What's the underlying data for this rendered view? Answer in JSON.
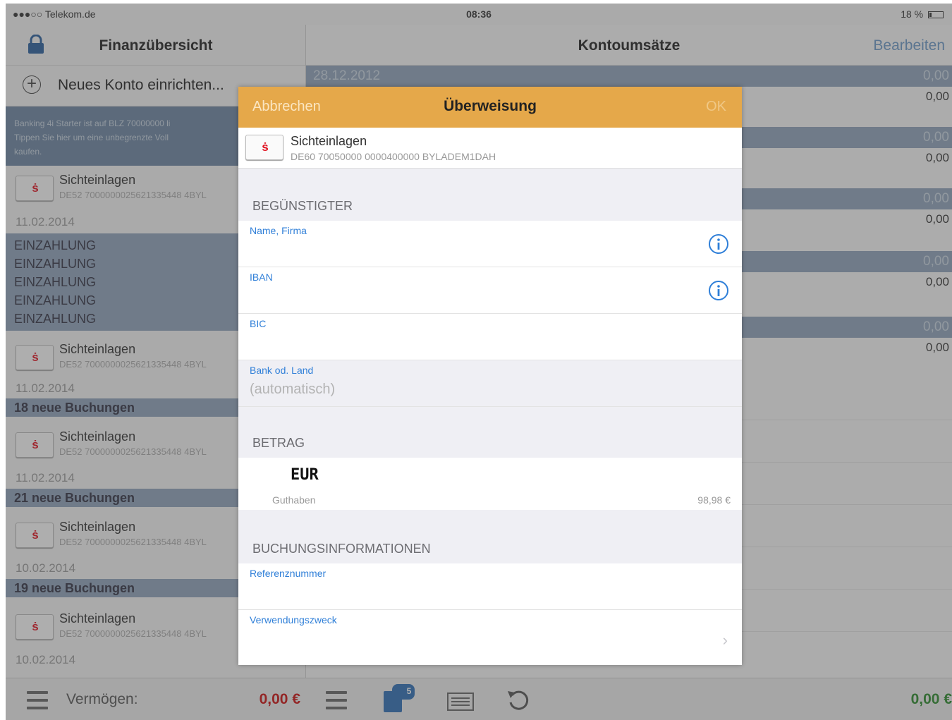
{
  "statusbar": {
    "carrier": "●●●○○ Telekom.de",
    "time": "08:36",
    "battery": "18 %"
  },
  "left": {
    "title": "Finanzübersicht",
    "new_account": "Neues Konto einrichten...",
    "promo_line1": "Banking 4i Starter ist auf BLZ 70000000 li",
    "promo_line2": "Tippen Sie hier um eine unbegrenzte Voll",
    "promo_line3": "kaufen.",
    "accounts": [
      {
        "name": "Sichteinlagen",
        "iban": "DE52 7000000025621335448 4BYL",
        "date": "11.02.2014",
        "entries": [
          "EINZAHLUNG",
          "EINZAHLUNG",
          "EINZAHLUNG",
          "EINZAHLUNG",
          "EINZAHLUNG"
        ]
      },
      {
        "name": "Sichteinlagen",
        "iban": "DE52 7000000025621335448 4BYL",
        "date": "11.02.2014",
        "bookings": "18 neue Buchungen"
      },
      {
        "name": "Sichteinlagen",
        "iban": "DE52 7000000025621335448 4BYL",
        "date": "11.02.2014",
        "bookings": "21 neue Buchungen"
      },
      {
        "name": "Sichteinlagen",
        "iban": "DE52 7000000025621335448 4BYL",
        "date": "10.02.2014",
        "bookings": "19 neue Buchungen"
      },
      {
        "name": "Sichteinlagen",
        "iban": "DE52 7000000025621335448 4BYL",
        "date": "10.02.2014"
      }
    ],
    "footer": {
      "assets_label": "Vermögen:",
      "assets_value": "0,00 €"
    }
  },
  "right": {
    "title": "Kontoumsätze",
    "edit": "Bearbeiten",
    "section_date": "28.12.2012",
    "zero": "0,00",
    "badge": "5",
    "total": "0,00 €"
  },
  "modal": {
    "cancel": "Abbrechen",
    "title": "Überweisung",
    "ok": "OK",
    "account_name": "Sichteinlagen",
    "account_iban": "DE60 70050000 0000400000 BYLADEM1DAH",
    "section_beneficiary": "BEGÜNSTIGTER",
    "field_name": "Name, Firma",
    "field_iban": "IBAN",
    "field_bic": "BIC",
    "field_bank": "Bank od. Land",
    "field_bank_placeholder": "(automatisch)",
    "section_amount": "BETRAG",
    "currency": "EUR",
    "balance_label": "Guthaben",
    "balance_value": "98,98 €",
    "section_booking": "BUCHUNGSINFORMATIONEN",
    "field_reference": "Referenznummer",
    "field_purpose": "Verwendungszweck"
  },
  "colors": {
    "accent": "#e5a84a",
    "link": "#2f7fd8",
    "negative": "#cc1111",
    "positive": "#2c8a2c",
    "section": "#8fa3ba"
  }
}
